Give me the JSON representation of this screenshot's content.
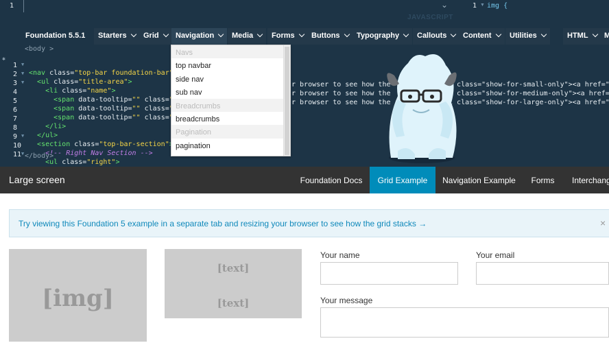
{
  "editor": {
    "top_line_number": "1",
    "panel_label": "JAVASCRIPT",
    "css_line_number": "1",
    "css_code": "img {"
  },
  "menubar": {
    "title": "Foundation 5.5.1",
    "items": [
      "Starters",
      "Grid",
      "Navigation",
      "Media",
      "Forms",
      "Buttons",
      "Typography",
      "Callouts",
      "Content",
      "Utilities",
      "HTML",
      "M"
    ]
  },
  "code": {
    "breadcrumb_top": "<body >",
    "breadcrumb_bottom": "</body>",
    "lines": [
      {
        "n": "1",
        "text": "<nav class=\"top-bar foundation-bar\""
      },
      {
        "n": "2",
        "text": "  <ul class=\"title-area\">"
      },
      {
        "n": "3",
        "text": "    <li class=\"name\">"
      },
      {
        "n": "4",
        "text": "      <span data-tooltip=\"\" class=\"ha"
      },
      {
        "n": "5",
        "text": "      <span data-tooltip=\"\" class=\"ha"
      },
      {
        "n": "6",
        "text": "      <span data-tooltip=\"\" class=\"ha"
      },
      {
        "n": "7",
        "text": "    </li>"
      },
      {
        "n": "8",
        "text": "  </ul>"
      },
      {
        "n": "9",
        "text": "  <section class=\"top-bar-section\">"
      },
      {
        "n": "10",
        "text": "    <!-- Right Nav Section -->"
      },
      {
        "n": "11",
        "text": "    <ul class=\"right\">"
      }
    ],
    "right_fragments": [
      "r browser to see how the gr",
      "r browser to see how the gr",
      "r browser to see how the gr"
    ],
    "far_right": [
      "h1 class=\"show-for-small-only\"><a href=\"#",
      "h1 class=\"show-for-medium-only\"><a href=\"#",
      "h1 class=\"show-for-large-only\"><a href=\"#"
    ]
  },
  "dropdown": {
    "rows": [
      {
        "label": "Navs",
        "header": true
      },
      {
        "label": "top navbar",
        "header": false
      },
      {
        "label": "side nav",
        "header": false
      },
      {
        "label": "sub nav",
        "header": false
      },
      {
        "label": "Breadcrumbs",
        "header": true
      },
      {
        "label": "breadcrumbs",
        "header": false
      },
      {
        "label": "Pagination",
        "header": true
      },
      {
        "label": "pagination",
        "header": false
      }
    ]
  },
  "pagenav": {
    "title": "Large screen",
    "links": [
      "Foundation Docs",
      "Grid Example",
      "Navigation Example",
      "Forms",
      "Interchange"
    ],
    "active": "Grid Example"
  },
  "page": {
    "alert_text": "Try viewing this Foundation 5 example in a separate tab and resizing your browser to see how the grid stacks →",
    "alert_close": "×",
    "img_placeholder": "[img]",
    "text_placeholder_1": "[text]",
    "text_placeholder_2": "[text]",
    "label_name": "Your name",
    "label_email": "Your email",
    "label_message": "Your message"
  },
  "colors": {
    "editor_bg": "#1d3446",
    "tag": "#65e46e",
    "string": "#f5d547",
    "comment": "#c27ee8",
    "nav_active": "#008cba",
    "nav_bg": "#333333"
  }
}
